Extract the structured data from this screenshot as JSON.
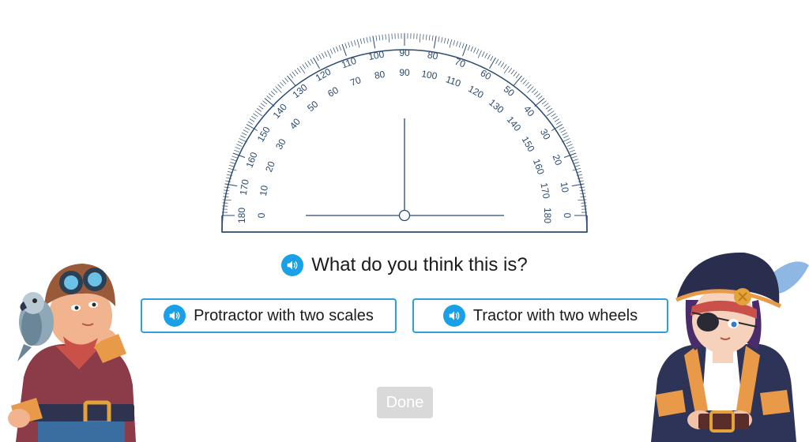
{
  "question": {
    "text": "What do you think this is?",
    "audio_icon": "speaker-icon"
  },
  "choices": [
    {
      "label": "Protractor with two scales",
      "audio_icon": "speaker-icon"
    },
    {
      "label": "Tractor with two wheels",
      "audio_icon": "speaker-icon"
    }
  ],
  "done_button": {
    "label": "Done",
    "state": "disabled"
  },
  "protractor": {
    "outer_scale_labels": [
      "0",
      "10",
      "20",
      "30",
      "40",
      "50",
      "60",
      "70",
      "80",
      "90",
      "100",
      "110",
      "120",
      "130",
      "140",
      "150",
      "160",
      "170",
      "180"
    ],
    "inner_scale_labels": [
      "0",
      "10",
      "20",
      "30",
      "40",
      "50",
      "60",
      "70",
      "80",
      "90",
      "100",
      "110",
      "120",
      "130",
      "140",
      "150",
      "160",
      "170",
      "180"
    ],
    "ray_angle_deg": 90
  },
  "characters": [
    {
      "name": "pirate-with-parrot",
      "icon": "pirate-with-parrot-illustration"
    },
    {
      "name": "pirate-captain",
      "icon": "pirate-captain-illustration"
    }
  ],
  "colors": {
    "accent": "#19a0e6",
    "button_border": "#2d9ee0",
    "protractor_ink": "#2b4a6f",
    "done_disabled": "#d9d9d9"
  }
}
